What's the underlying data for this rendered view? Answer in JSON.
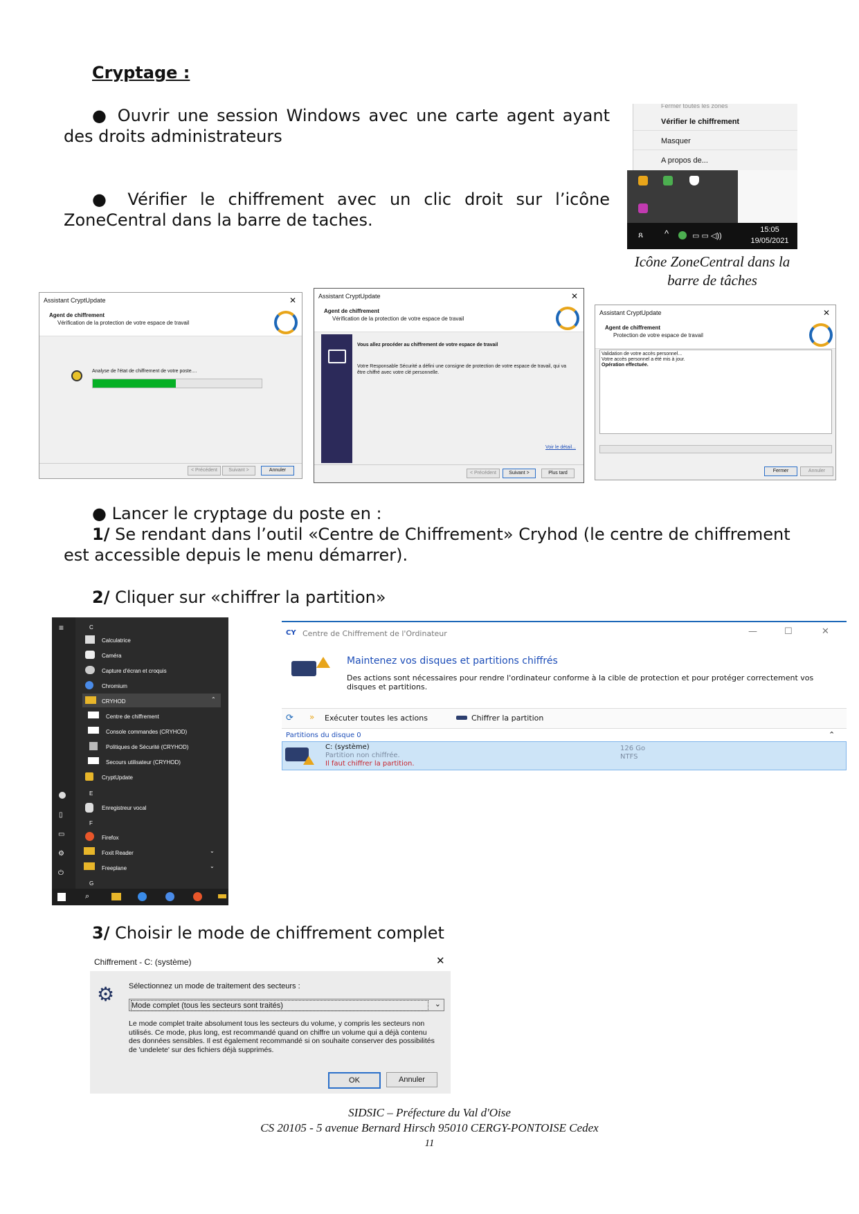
{
  "section_title": "Cryptage :",
  "bullets": {
    "b1": "● Ouvrir une session Windows avec une carte agent ayant des droits administrateurs",
    "b2": "● Vérifier le chiffrement avec un clic droit sur l’icône ZoneCentral dans la barre de taches.",
    "b3": "● Lancer le cryptage du poste en :",
    "s1_num": "1/",
    "s1_text": " Se rendant dans l’outil «Centre de Chiffrement» Cryhod (le centre de chiffrement est accessible depuis le menu démarrer).",
    "s2_num": "2/",
    "s2_text": " Cliquer sur «chiffrer la partition»",
    "s3_num": "3/",
    "s3_text": " Choisir le mode de chiffrement complet"
  },
  "tray": {
    "menu_top": "Fermer toutes les zones",
    "menu_items": [
      "Vérifier le chiffrement",
      "Masquer",
      "A propos de..."
    ],
    "time": "15:05",
    "date": "19/05/2021",
    "caption": "Icône ZoneCentral dans la barre de tâches"
  },
  "wizard": {
    "title": "Assistant CryptUpdate",
    "head_title": "Agent de chiffrement",
    "head_sub_a": "Vérification de la protection de votre espace de travail",
    "head_sub_c": "Protection de votre espace de travail",
    "analysis_text": "Analyse de l'état de chiffrement de votre poste....",
    "progress": 0.49,
    "b_title": "Vous allez procéder au chiffrement de votre espace de travail",
    "b_body": "Votre Responsable Sécurité a défini une consigne de protection de votre espace de travail, qui va être chiffré avec votre clé personnelle.",
    "b_detail": "Voir le détail...",
    "log_lines": [
      "Validation de votre accès personnel...",
      "Votre accès personnel a été mis à jour.",
      "Opération effectuée."
    ],
    "btn_prev": "< Précédent",
    "btn_next": "Suivant >",
    "btn_cancel": "Annuler",
    "btn_later": "Plus tard",
    "btn_close": "Fermer"
  },
  "startmenu": {
    "letters": [
      "C",
      "E",
      "F",
      "G"
    ],
    "items_c": [
      "Calculatrice",
      "Caméra",
      "Capture d'écran et croquis",
      "Chromium",
      "CRYHOD"
    ],
    "items_cryhod": [
      "Centre de chiffrement",
      "Console commandes (CRYHOD)",
      "Politiques de Sécurité (CRYHOD)",
      "Secours utilisateur (CRYHOD)"
    ],
    "item_crypt": "CryptUpdate",
    "items_e": [
      "Enregistreur vocal"
    ],
    "items_f": [
      "Firefox",
      "Foxit Reader",
      "Freeplane"
    ]
  },
  "centre": {
    "title": "Centre de Chiffrement de l'Ordinateur",
    "heading": "Maintenez vos disques et partitions chiffrés",
    "desc": "Des actions sont nécessaires pour rendre l'ordinateur conforme à la cible de protection et pour protéger correctement vos disques et partitions.",
    "action1": "Exécuter toutes les actions",
    "action2": "Chiffrer la partition",
    "group": "Partitions du disque 0",
    "drive_name": "C: (système)",
    "drive_status": "Partition non chiffrée.",
    "drive_warning": "Il faut chiffrer la partition.",
    "size": "126 Go",
    "fs": "NTFS"
  },
  "dialog": {
    "title": "Chiffrement - C: (système)",
    "label": "Sélectionnez un mode de traitement des secteurs :",
    "selected": "Mode complet (tous les secteurs sont traités)",
    "desc": "Le mode complet traite absolument tous les secteurs du volume, y compris les secteurs non utilisés. Ce mode, plus long, est recommandé quand on chiffre un volume qui a déjà contenu des données sensibles. Il est également recommandé si on souhaite conserver des possibilités de 'undelete' sur des fichiers déjà supprimés.",
    "ok": "OK",
    "cancel": "Annuler"
  },
  "footer": {
    "line1": "SIDSIC – Préfecture du Val d'Oise",
    "line2": "CS 20105 - 5 avenue Bernard Hirsch  95010 CERGY-PONTOISE Cedex",
    "page": "11"
  }
}
